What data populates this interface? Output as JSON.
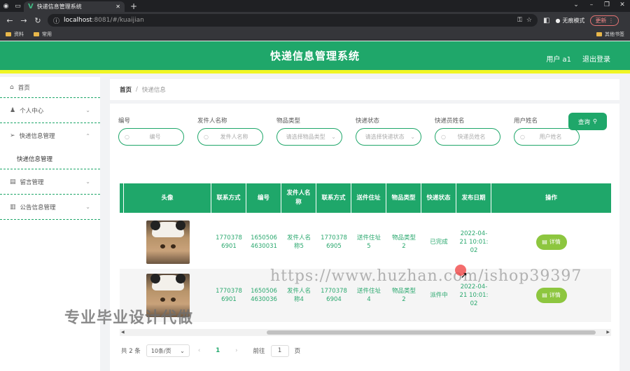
{
  "browser": {
    "tab_title": "快递信息管理系统",
    "url_host": "localhost",
    "url_path": ":8081/#/kuaijian",
    "incognito_label": "无痕模式",
    "update_label": "更新",
    "bookmarks": [
      "资料",
      "常用"
    ],
    "bookmarks_right": "其他书签"
  },
  "header": {
    "title": "快递信息管理系统",
    "user_label": "用户 a1",
    "logout_label": "退出登录"
  },
  "sidebar": {
    "items": [
      {
        "label": "首页"
      },
      {
        "label": "个人中心"
      },
      {
        "label": "快递信息管理"
      },
      {
        "label": "快递信息管理"
      },
      {
        "label": "留言管理"
      },
      {
        "label": "公告信息管理"
      }
    ]
  },
  "breadcrumb": {
    "home": "首页",
    "separator": "/",
    "current": "快递信息"
  },
  "filters": [
    {
      "label": "编号",
      "placeholder": "编号"
    },
    {
      "label": "发件人名称",
      "placeholder": "发件人名称"
    },
    {
      "label": "物品类型",
      "placeholder": "请选择物品类型"
    },
    {
      "label": "快递状态",
      "placeholder": "请选择快递状态"
    },
    {
      "label": "快递员姓名",
      "placeholder": "快递员姓名"
    },
    {
      "label": "用户姓名",
      "placeholder": "用户姓名"
    }
  ],
  "query_button": "查询",
  "table": {
    "headers": [
      "头像",
      "联系方式",
      "编号",
      "发件人名称",
      "联系方式",
      "送件住址",
      "物品类型",
      "快递状态",
      "发布日期",
      "操作"
    ],
    "rows": [
      {
        "contact1": "17703786901",
        "number": "16505064630031",
        "sender": "发件人名称5",
        "contact2": "17703786905",
        "address": "送件住址5",
        "item_type": "物品类型2",
        "status": "已完成",
        "date": "2022-04-21 10:01:02",
        "action": "详情"
      },
      {
        "contact1": "17703786901",
        "number": "16505064630036",
        "sender": "发件人名称4",
        "contact2": "17703786904",
        "address": "送件住址4",
        "item_type": "物品类型2",
        "status": "派件中",
        "date": "2022-04-21 10:01:02",
        "action": "详情"
      }
    ]
  },
  "pagination": {
    "total": "共 2 条",
    "page_size": "10条/页",
    "current_page": "1",
    "goto_label": "前往",
    "goto_value": "1",
    "page_suffix": "页"
  },
  "watermarks": {
    "url": "https://www.huzhan.com/ishop39397",
    "text": "专业毕业设计代做"
  },
  "colors": {
    "primary": "#1fa76a",
    "accent_bar": "#f0f524",
    "detail_button": "#8dc63f"
  }
}
